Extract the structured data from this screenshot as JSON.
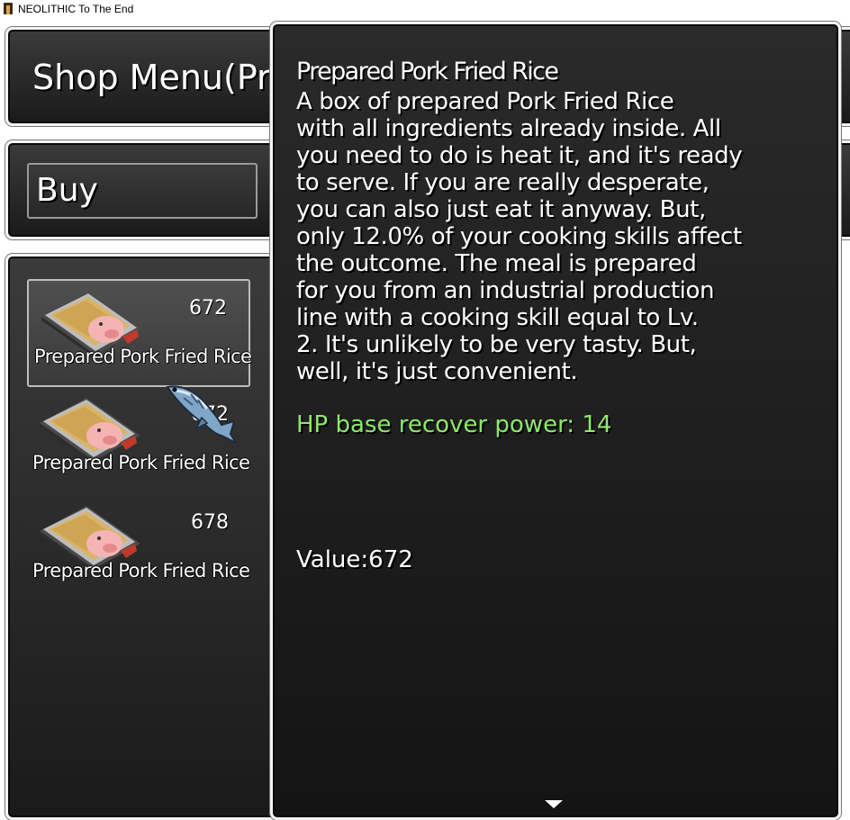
{
  "window": {
    "title": "NEOLITHIC To The End"
  },
  "shop": {
    "title": "Shop Menu(Pre",
    "mode_label": "Buy"
  },
  "items": [
    {
      "name": "Prepared Pork Fried Rice",
      "price": "672",
      "selected": true
    },
    {
      "name": "Prepared Pork Fried Rice",
      "price": "672",
      "selected": false
    },
    {
      "name": "Prepared Pork Fried Rice",
      "price": "678",
      "selected": false
    }
  ],
  "details": {
    "title": "Prepared Pork Fried Rice",
    "lines": [
      "A box of prepared Pork Fried Rice",
      "with all ingredients already inside. All",
      "you need to do is heat it, and it's ready",
      "to serve. If you are really desperate,",
      "you can also just eat it anyway. But,",
      "only 12.0% of your cooking skills affect",
      "the outcome. The meal is prepared",
      "for you from an industrial production",
      "line with a cooking skill equal to Lv.",
      "2. It's unlikely to be very tasty. But,",
      "well, it's just convenient."
    ],
    "hp_text": "HP base recover power: 14",
    "value_text": "Value:672"
  },
  "colors": {
    "hp_green": "#8ee86b",
    "window_border": "#f4f4f4"
  },
  "icons": {
    "cursor": "fish-cursor-icon",
    "item": "pork-fried-rice-icon",
    "more": "scroll-down-arrow-icon"
  }
}
